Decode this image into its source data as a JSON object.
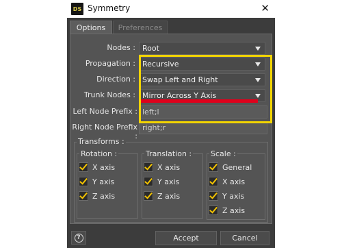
{
  "window": {
    "icon_text": "DS",
    "title": "Symmetry",
    "close_glyph": "✕"
  },
  "tabs": [
    {
      "label": "Options",
      "active": true
    },
    {
      "label": "Preferences",
      "active": false
    }
  ],
  "options": {
    "nodes": {
      "label": "Nodes :",
      "value": "Root"
    },
    "propagation": {
      "label": "Propagation :",
      "value": "Recursive"
    },
    "direction": {
      "label": "Direction :",
      "value": "Swap Left and Right"
    },
    "trunk_nodes": {
      "label": "Trunk Nodes :",
      "value": "Mirror Across Y Axis"
    },
    "left_prefix": {
      "label": "Left Node Prefix :",
      "value": "left;l"
    },
    "right_prefix": {
      "label": "Right Node Prefix :",
      "value": "right;r"
    }
  },
  "transforms": {
    "title": "Transforms :",
    "rotation": {
      "title": "Rotation :",
      "items": [
        "X axis",
        "Y axis",
        "Z axis"
      ]
    },
    "translation": {
      "title": "Translation :",
      "items": [
        "X axis",
        "Y axis",
        "Z axis"
      ]
    },
    "scale": {
      "title": "Scale :",
      "items": [
        "General",
        "X axis",
        "Y axis",
        "Z axis"
      ]
    }
  },
  "footer": {
    "help_glyph": "?",
    "accept_label": "Accept",
    "cancel_label": "Cancel"
  },
  "colors": {
    "annotation_box": "#f2d400",
    "annotation_line": "#e0001b",
    "checkmark": "#f3c300"
  }
}
